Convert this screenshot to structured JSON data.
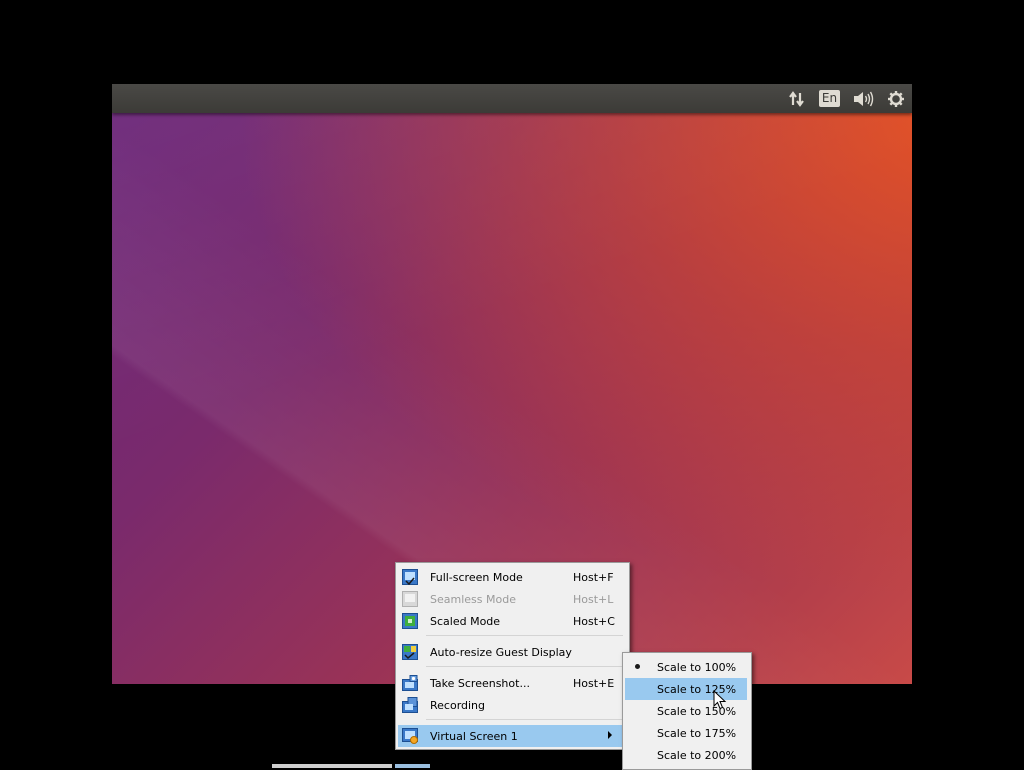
{
  "tray": {
    "network_icon": "network-updown-icon",
    "keyboard_layout": "En",
    "volume_icon": "speaker-icon",
    "settings_icon": "gear-icon"
  },
  "menu": {
    "items": [
      {
        "label": "Full-screen Mode",
        "shortcut": "Host+F",
        "enabled": true,
        "icon": "fullscreen-icon"
      },
      {
        "label": "Seamless Mode",
        "shortcut": "Host+L",
        "enabled": false,
        "icon": "seamless-icon"
      },
      {
        "label": "Scaled Mode",
        "shortcut": "Host+C",
        "enabled": true,
        "icon": "scaled-icon"
      },
      {
        "label": "Auto-resize Guest Display",
        "shortcut": "",
        "enabled": true,
        "icon": "auto-resize-icon"
      },
      {
        "label": "Take Screenshot...",
        "shortcut": "Host+E",
        "enabled": true,
        "icon": "camera-icon"
      },
      {
        "label": "Recording",
        "shortcut": "",
        "enabled": true,
        "icon": "recording-icon"
      },
      {
        "label": "Virtual Screen 1",
        "shortcut": "",
        "enabled": true,
        "icon": "virtual-screen-icon",
        "has_submenu": true,
        "highlighted": true
      }
    ]
  },
  "submenu": {
    "items": [
      {
        "label": "Scale to 100%",
        "selected": true
      },
      {
        "label": "Scale to 125%",
        "highlighted": true
      },
      {
        "label": "Scale to 150%"
      },
      {
        "label": "Scale to 175%"
      },
      {
        "label": "Scale to 200%"
      }
    ]
  },
  "colors": {
    "menu_bg": "#f0f0f0",
    "highlight": "#99c9ef",
    "topbar": "#3c3b37",
    "wallpaper_purple": "#6a2578",
    "wallpaper_orange": "#e85423"
  }
}
